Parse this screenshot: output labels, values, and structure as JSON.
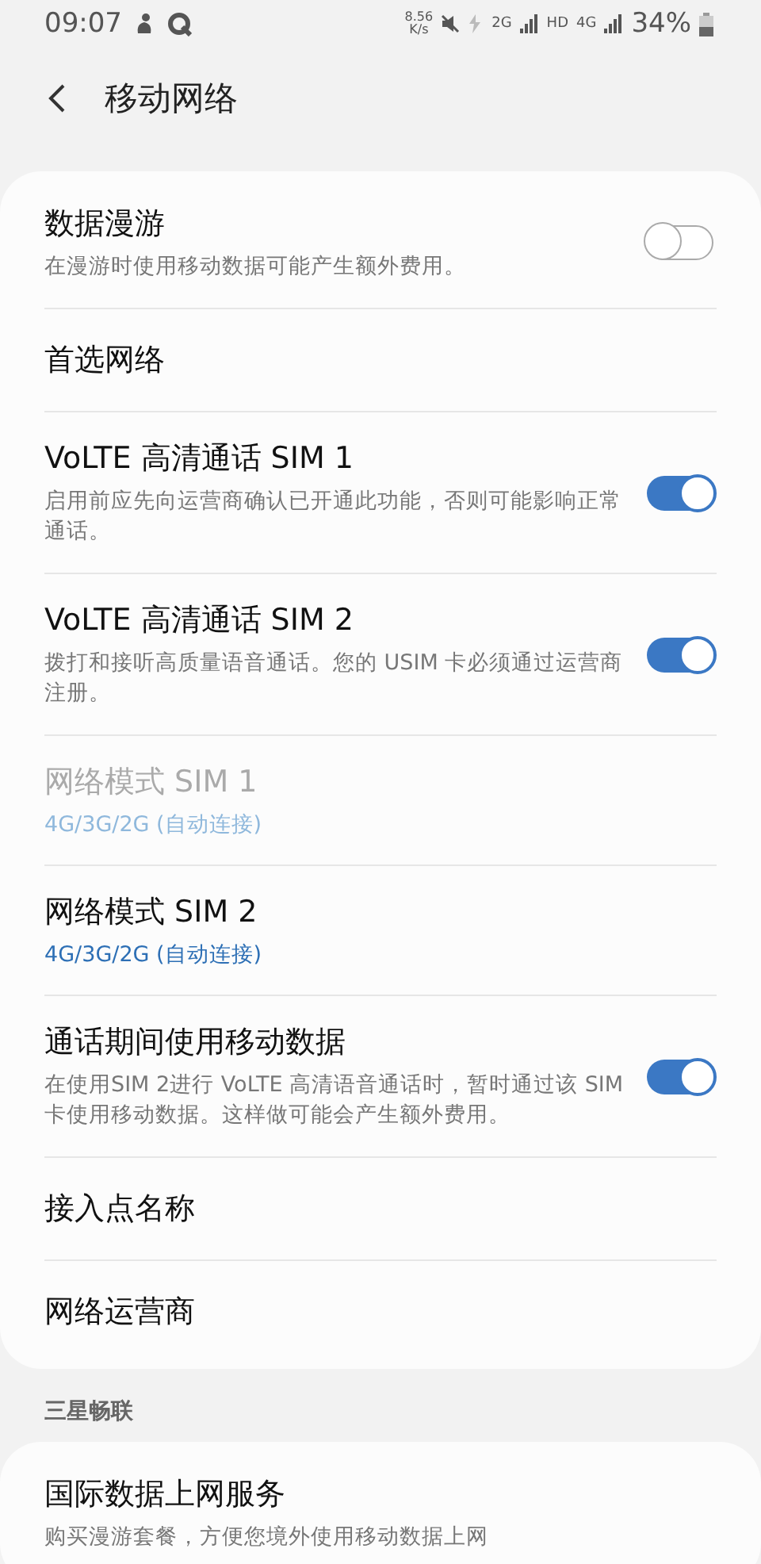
{
  "status_bar": {
    "time": "09:07",
    "speed": "8.56",
    "speed_unit": "K/s",
    "network_2g": "2G",
    "hd": "HD",
    "network_4g": "4G",
    "battery": "34%"
  },
  "header": {
    "title": "移动网络"
  },
  "sections": [
    {
      "items": [
        {
          "kind": "toggle",
          "title": "数据漫游",
          "subtitle": "在漫游时使用移动数据可能产生额外费用。",
          "on": false,
          "disabled": false
        },
        {
          "kind": "plain",
          "title": "首选网络",
          "disabled": false
        },
        {
          "kind": "toggle",
          "title": "VoLTE 高清通话 SIM 1",
          "subtitle": "启用前应先向运营商确认已开通此功能，否则可能影响正常通话。",
          "on": true,
          "disabled": false
        },
        {
          "kind": "toggle",
          "title": "VoLTE 高清通话 SIM 2",
          "subtitle": "拨打和接听高质量语音通话。您的 USIM 卡必须通过运营商注册。",
          "on": true,
          "disabled": false
        },
        {
          "kind": "value",
          "title": "网络模式 SIM 1",
          "value": "4G/3G/2G (自动连接)",
          "disabled": true
        },
        {
          "kind": "value",
          "title": "网络模式 SIM 2",
          "value": "4G/3G/2G (自动连接)",
          "disabled": false
        },
        {
          "kind": "toggle",
          "title": "通话期间使用移动数据",
          "subtitle": "在使用SIM 2进行 VoLTE 高清语音通话时，暂时通过该 SIM 卡使用移动数据。这样做可能会产生额外费用。",
          "on": true,
          "disabled": false
        },
        {
          "kind": "plain",
          "title": "接入点名称",
          "disabled": false
        },
        {
          "kind": "plain",
          "title": "网络运营商",
          "disabled": false
        }
      ]
    },
    {
      "header": "三星畅联",
      "items": [
        {
          "kind": "plain",
          "title": "国际数据上网服务",
          "subtitle": "购买漫游套餐，方便您境外使用移动数据上网",
          "disabled": false
        }
      ]
    }
  ]
}
